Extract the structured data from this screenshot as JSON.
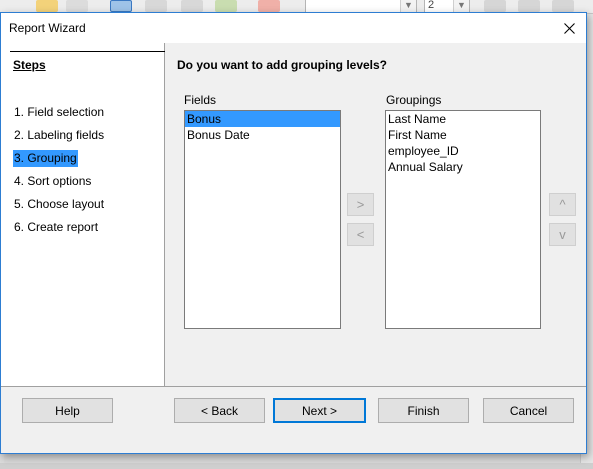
{
  "window": {
    "title": "Report Wizard"
  },
  "steps": {
    "title": "Steps",
    "items": [
      "1. Field selection",
      "2. Labeling fields",
      "3. Grouping",
      "4. Sort options",
      "5. Choose layout",
      "6. Create report"
    ],
    "selected_index": 2
  },
  "content": {
    "question": "Do you want to add grouping levels?",
    "fields_label": "Fields",
    "fields": [
      "Bonus",
      "Bonus Date"
    ],
    "fields_selected": "Bonus",
    "groupings_label": "Groupings",
    "groupings": [
      "Last Name",
      "First Name",
      "employee_ID",
      "Annual Salary"
    ],
    "add_label": ">",
    "remove_label": "<",
    "up_label": "^",
    "down_label": "v"
  },
  "buttons": {
    "help": "Help",
    "back": "< Back",
    "next": "Next >",
    "finish": "Finish",
    "cancel": "Cancel"
  },
  "background_toolbar": {
    "font_size_value": "2"
  },
  "colors": {
    "selection": "#3399ff",
    "dialog_border": "#2d7dd2",
    "default_button_border": "#0078d7"
  }
}
